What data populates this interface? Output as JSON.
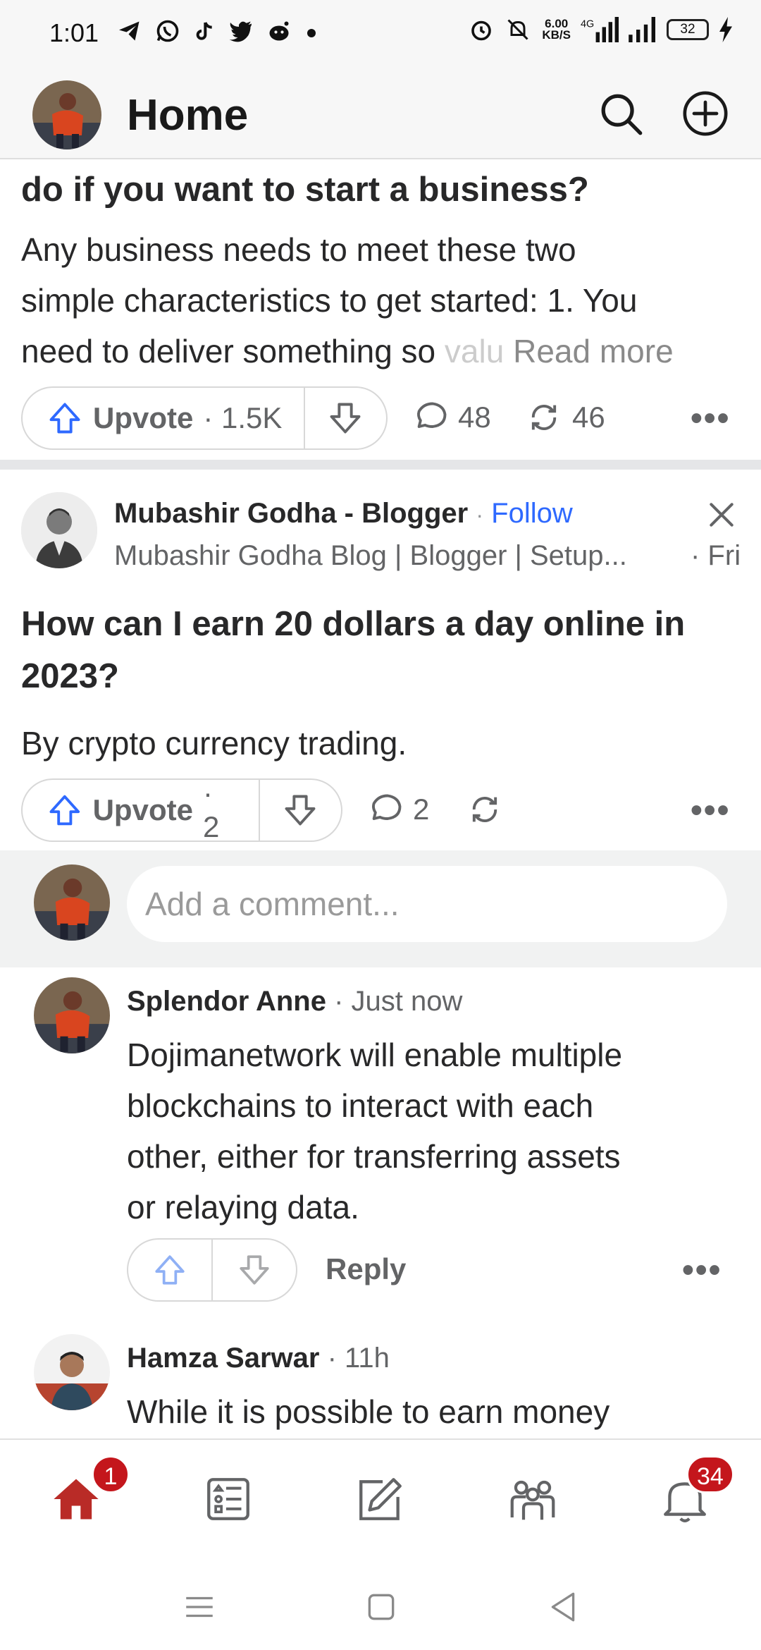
{
  "status_bar": {
    "time": "1:01",
    "net_speed_value": "6.00",
    "net_speed_unit": "KB/S",
    "network": "4G",
    "battery": "32",
    "icons": [
      "telegram-icon",
      "whatsapp-icon",
      "tiktok-icon",
      "twitter-icon",
      "reddit-icon",
      "dot-icon",
      "alarm-icon",
      "mute-icon",
      "signal-icon",
      "signal-icon",
      "battery-icon",
      "charging-icon"
    ]
  },
  "header": {
    "title": "Home",
    "search_icon": "search-icon",
    "add_icon": "add-icon"
  },
  "post1": {
    "title_fragment": "do if you want to start a business?",
    "body_line1": "Any business needs to meet these two",
    "body_line2": "simple characteristics to get started: 1. You",
    "body_line3": "need to deliver something so ",
    "body_fade": "valu",
    "read_more": "Read more",
    "upvote_label": "Upvote",
    "upvote_count": "· 1.5K",
    "comment_count": "48",
    "share_count": "46"
  },
  "post2": {
    "author": "Mubashir Godha - Blogger",
    "follow": "Follow",
    "credential": "Mubashir Godha Blog | Blogger | Setup...",
    "date": "· Fri",
    "question_line1": "How can I earn 20 dollars a day online in",
    "question_line2": "2023?",
    "answer": "By crypto currency trading.",
    "upvote_label": "Upvote",
    "upvote_count": "· 2",
    "comment_count": "2"
  },
  "comment_box": {
    "placeholder": "Add a comment..."
  },
  "comments": [
    {
      "author": "Splendor Anne",
      "time": "· Just now",
      "line1": "Dojimanetwork will enable multiple",
      "line2": "blockchains to interact with each",
      "line3": "other, either for transferring assets",
      "line4": "or relaying data.",
      "reply": "Reply"
    },
    {
      "author": "Hamza Sarwar",
      "time": "· 11h",
      "line1": "While it is possible to earn money"
    }
  ],
  "bottom_nav": {
    "home_badge": "1",
    "notifications_badge": "34",
    "items": [
      "home-icon",
      "following-icon",
      "answer-icon",
      "spaces-icon",
      "notifications-icon"
    ]
  },
  "colors": {
    "brand_red": "#b92b27",
    "badge_red": "#c4161c",
    "link_blue": "#2e69ff",
    "upvote_blue": "#2e69ff"
  }
}
